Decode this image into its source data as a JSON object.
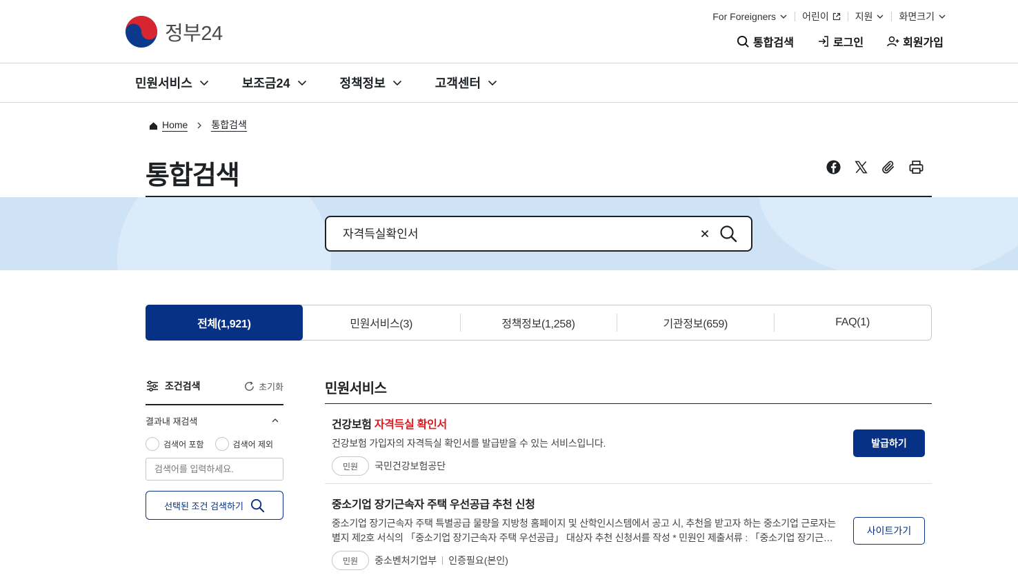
{
  "header": {
    "logo_text": "정부24",
    "util": [
      {
        "label": "For Foreigners",
        "icon": "chevron-down-icon"
      },
      {
        "label": "어린이",
        "icon": "external-link-icon"
      },
      {
        "label": "지원",
        "icon": "chevron-down-icon"
      },
      {
        "label": "화면크기",
        "icon": "chevron-down-icon"
      }
    ],
    "member": {
      "search": "통합검색",
      "login": "로그인",
      "signup": "회원가입"
    }
  },
  "gnb": [
    {
      "label": "민원서비스"
    },
    {
      "label": "보조금24"
    },
    {
      "label": "정책정보"
    },
    {
      "label": "고객센터"
    }
  ],
  "breadcrumb": {
    "home": "Home",
    "current": "통합검색"
  },
  "page": {
    "title": "통합검색"
  },
  "search": {
    "value": "자격득실확인서"
  },
  "tabs": [
    {
      "label": "전체(1,921)",
      "active": true
    },
    {
      "label": "민원서비스(3)",
      "active": false
    },
    {
      "label": "정책정보(1,258)",
      "active": false
    },
    {
      "label": "기관정보(659)",
      "active": false
    },
    {
      "label": "FAQ(1)",
      "active": false
    }
  ],
  "filter": {
    "title": "조건검색",
    "reset": "초기화",
    "re_search": "결과내 재검색",
    "include": "검색어 포함",
    "exclude": "검색어 제외",
    "placeholder": "검색어를 입력하세요.",
    "submit": "선택된 조건 검색하기"
  },
  "results": {
    "section_title": "민원서비스",
    "items": [
      {
        "title_prefix": "건강보험 ",
        "title_highlight": "자격득실 확인서",
        "desc": "건강보험 가입자의 자격득실 확인서를 발급받을 수 있는 서비스입니다.",
        "badge": "민원",
        "org": "국민건강보험공단",
        "action": "발급하기"
      },
      {
        "title": "중소기업 장기근속자 주택 우선공급 추천 신청",
        "desc": "중소기업 장기근속자 주택 특별공급 물량을 지방청 홈페이지 및 산학인시스템에서 공고 시, 추천을 받고자 하는 중소기업 근로자는 별지 제2호 서식의 「중소기업 장기근속자 주택 우선공급」 대상자 추천 신청서를 작성 * 민원인 제출서류 : 「중소기업 장기근속자 주택 우선공급」 대상자 추천 신청서",
        "badge": "민원",
        "org": "중소벤처기업부",
        "auth": "인증필요(본인)",
        "action": "사이트가기"
      }
    ]
  },
  "colors": {
    "primary": "#063185",
    "highlight": "#e0191f",
    "band": "#cfe3f7"
  }
}
